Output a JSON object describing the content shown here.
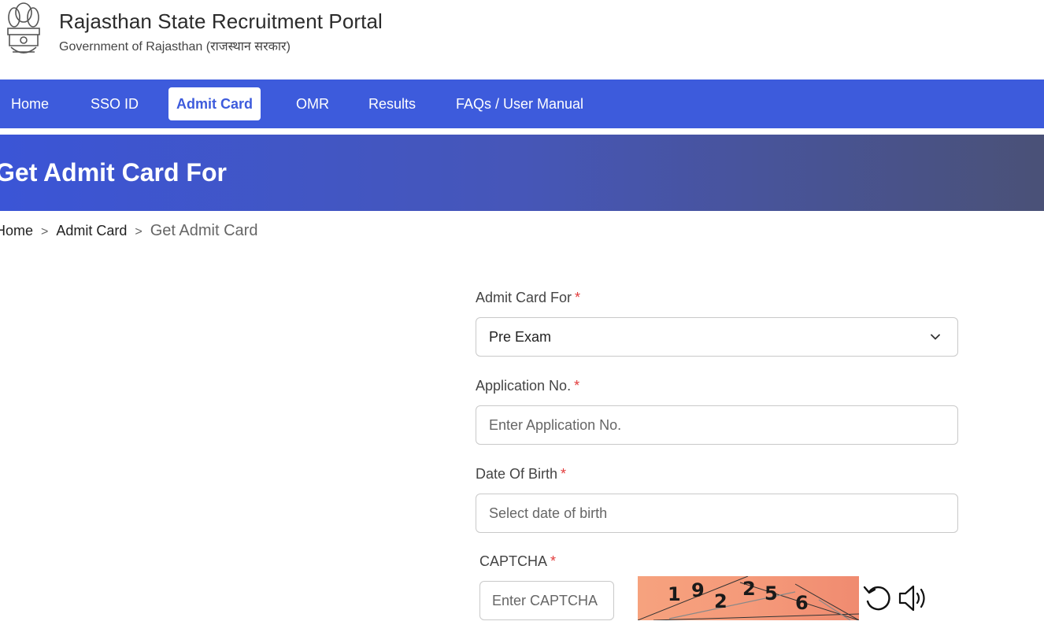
{
  "header": {
    "title": "Rajasthan State Recruitment Portal",
    "subtitle": "Government of Rajasthan (राजस्थान सरकार)",
    "logo_icon": "state-emblem-icon"
  },
  "nav": {
    "items": [
      {
        "label": "Home"
      },
      {
        "label": "SSO ID"
      },
      {
        "label": "Admit Card",
        "active": true
      },
      {
        "label": "OMR"
      },
      {
        "label": "Results"
      },
      {
        "label": "FAQs / User Manual"
      }
    ]
  },
  "banner": {
    "title": "Get Admit Card For"
  },
  "breadcrumb": {
    "items": [
      "Home",
      "Admit Card",
      "Get Admit Card"
    ],
    "separator": ">"
  },
  "form": {
    "admit_card_for": {
      "label": "Admit Card For",
      "required": "*",
      "value": "Pre Exam"
    },
    "application_no": {
      "label": "Application No.",
      "required": "*",
      "placeholder": "Enter Application No."
    },
    "dob": {
      "label": "Date Of Birth",
      "required": "*",
      "placeholder": "Select date of birth"
    },
    "captcha": {
      "label": "CAPTCHA",
      "required": "*",
      "placeholder": "Enter CAPTCHA",
      "image_text": "1 9 2 2 5 6"
    }
  },
  "colors": {
    "primary": "#3d5bdc",
    "required": "#e23b3b"
  }
}
